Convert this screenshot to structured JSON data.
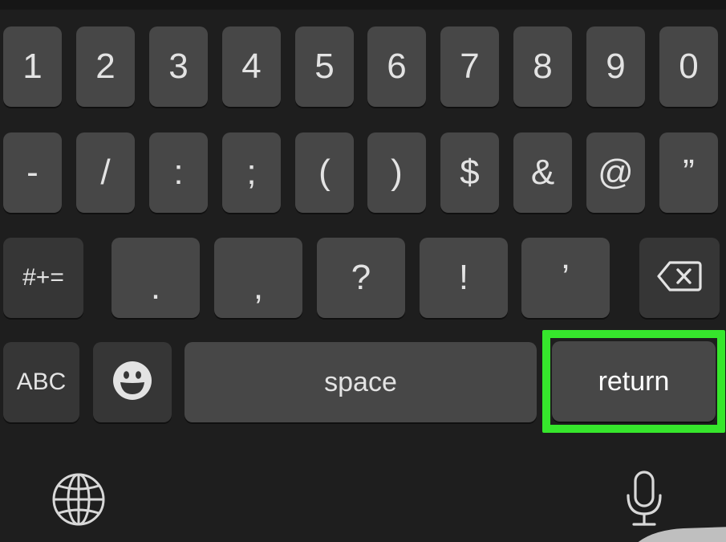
{
  "keyboard": {
    "number_row": [
      "1",
      "2",
      "3",
      "4",
      "5",
      "6",
      "7",
      "8",
      "9",
      "0"
    ],
    "symbol_row": [
      "-",
      "/",
      ":",
      ";",
      "(",
      ")",
      "$",
      "&",
      "@",
      "”"
    ],
    "punct_row": [
      ".",
      ",",
      "?",
      "!",
      "’"
    ],
    "more_symbols_label": "#+=",
    "abc_label": "ABC",
    "space_label": "space",
    "return_label": "return"
  },
  "icons": {
    "backspace": "backspace-icon",
    "emoji": "emoji-icon",
    "globe": "globe-icon",
    "microphone": "microphone-icon"
  },
  "colors": {
    "keyboard_bg": "#1e1e1e",
    "key_bg": "#474747",
    "function_key_bg": "#363636",
    "key_text": "#e3e3e3",
    "highlight": "#36e62c"
  }
}
